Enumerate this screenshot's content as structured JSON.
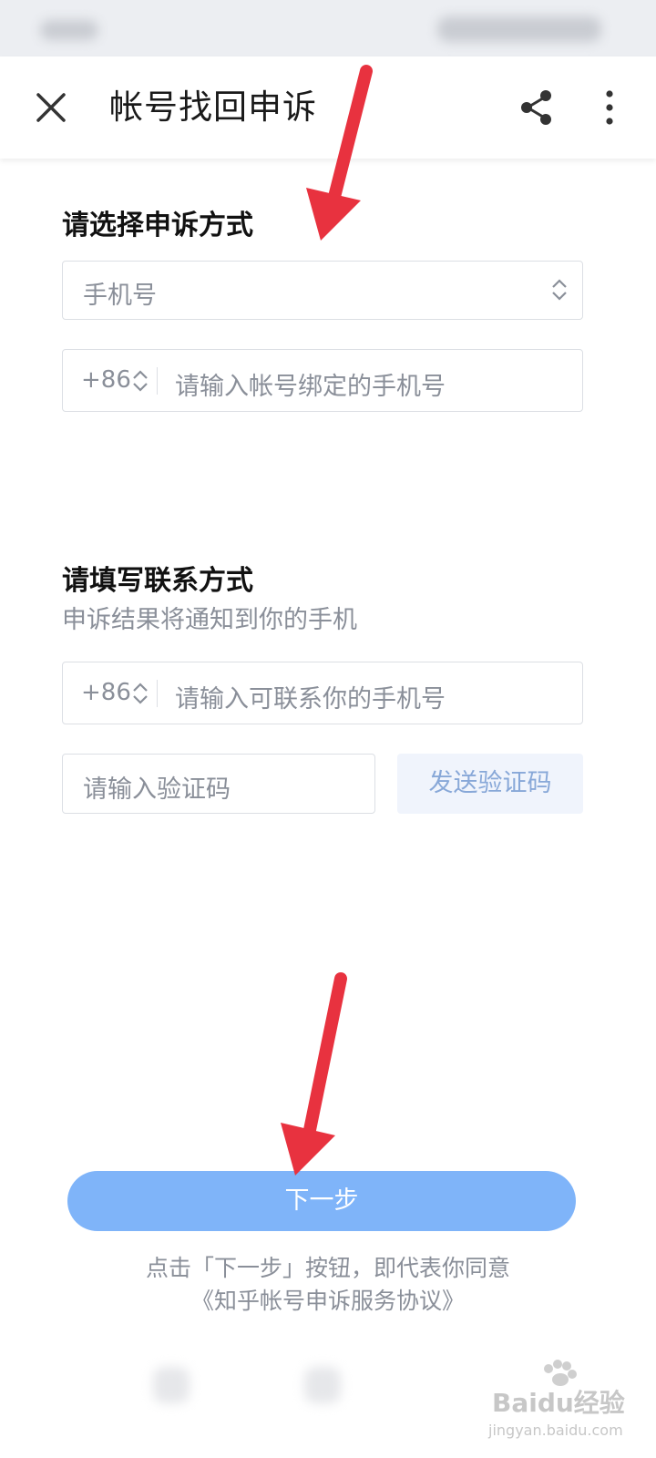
{
  "header": {
    "title": "帐号找回申诉",
    "close_icon": "close-icon",
    "share_icon": "share-icon",
    "more_icon": "more-vertical-icon"
  },
  "appeal_method": {
    "title": "请选择申诉方式",
    "select_value": "手机号",
    "phone_country_code": "+86",
    "phone_placeholder": "请输入帐号绑定的手机号"
  },
  "contact": {
    "title": "请填写联系方式",
    "subtitle": "申诉结果将通知到你的手机",
    "phone_country_code": "+86",
    "phone_placeholder": "请输入可联系你的手机号",
    "code_placeholder": "请输入验证码",
    "send_code_label": "发送验证码"
  },
  "footer": {
    "next_label": "下一步",
    "agreement_line1": "点击「下一步」按钮，即代表你同意",
    "agreement_link": "《知乎帐号申诉服务协议》"
  },
  "watermark": {
    "brand": "Baidu经验",
    "url": "jingyan.baidu.com"
  },
  "colors": {
    "primary_button": "#7fb4f9",
    "send_code_bg": "#f0f4fc",
    "send_code_text": "#88a8d8",
    "annotation_arrow": "#e8323f",
    "hint_text": "#8a8f99"
  }
}
